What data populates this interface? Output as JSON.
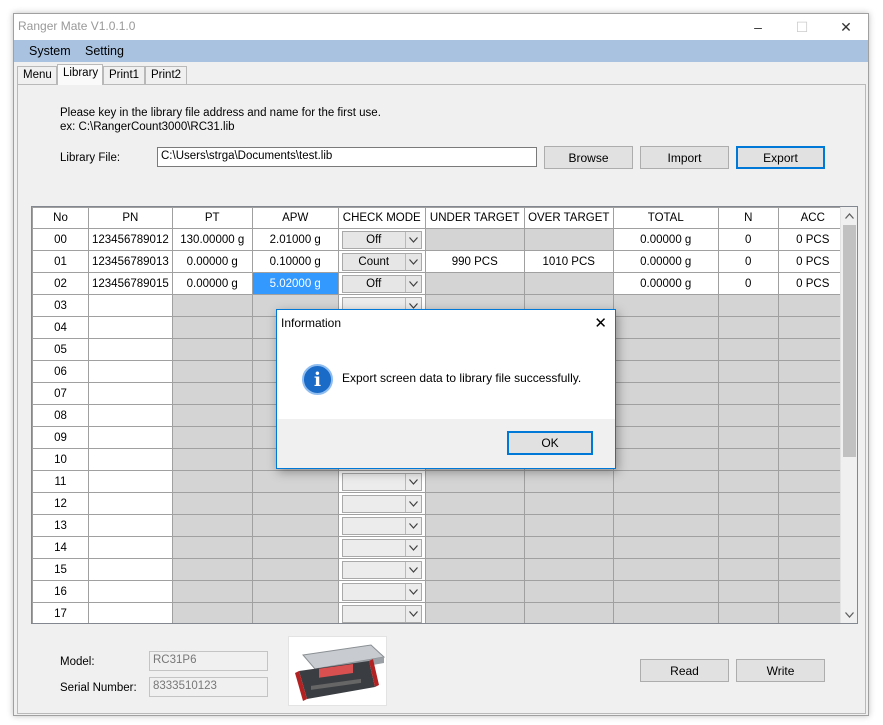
{
  "window": {
    "title": "Ranger Mate   V1.0.1.0",
    "controls": {
      "minimize": "–",
      "maximize": "☐",
      "close": "✕"
    }
  },
  "menu": {
    "items": [
      "System",
      "Setting"
    ]
  },
  "tabs": [
    "Menu",
    "Library",
    "Print1",
    "Print2"
  ],
  "active_tab": "Library",
  "library": {
    "instruction_line1": "Please key in the library file address and name for the first use.",
    "instruction_line2": "ex: C:\\RangerCount3000\\RC31.lib",
    "file_label": "Library File:",
    "file_value": "C:\\Users\\strga\\Documents\\test.lib",
    "browse": "Browse",
    "import": "Import",
    "export": "Export"
  },
  "grid": {
    "columns": [
      "No",
      "PN",
      "PT",
      "APW",
      "CHECK MODE",
      "UNDER TARGET",
      "OVER TARGET",
      "TOTAL",
      "N",
      "ACC"
    ],
    "rows": [
      {
        "no": "00",
        "pn": "123456789012",
        "pt": "130.00000 g",
        "apw": "2.01000 g",
        "mode": "Off",
        "under": "",
        "over": "",
        "total": "0.00000 g",
        "n": "0",
        "acc": "0 PCS"
      },
      {
        "no": "01",
        "pn": "123456789013",
        "pt": "0.00000 g",
        "apw": "0.10000 g",
        "mode": "Count",
        "under": "990 PCS",
        "over": "1010 PCS",
        "total": "0.00000 g",
        "n": "0",
        "acc": "0 PCS"
      },
      {
        "no": "02",
        "pn": "123456789015",
        "pt": "0.00000 g",
        "apw": "5.02000 g",
        "mode": "Off",
        "under": "",
        "over": "",
        "total": "0.00000 g",
        "n": "0",
        "acc": "0 PCS"
      }
    ],
    "empty_rows": [
      "03",
      "04",
      "05",
      "06",
      "07",
      "08",
      "09",
      "10",
      "11",
      "12",
      "13",
      "14",
      "15",
      "16",
      "17"
    ]
  },
  "device": {
    "model_label": "Model:",
    "model_value": "RC31P6",
    "serial_label": "Serial Number:",
    "serial_value": "8333510123"
  },
  "actions": {
    "read": "Read",
    "write": "Write"
  },
  "dialog": {
    "title": "Information",
    "message": "Export screen data to library file successfully.",
    "ok": "OK",
    "icon": "info-icon"
  },
  "colors": {
    "menubar": "#a8c2e0",
    "accent": "#0078d7",
    "selection": "#3399ff",
    "grid_gray": "#d4d4d4"
  }
}
